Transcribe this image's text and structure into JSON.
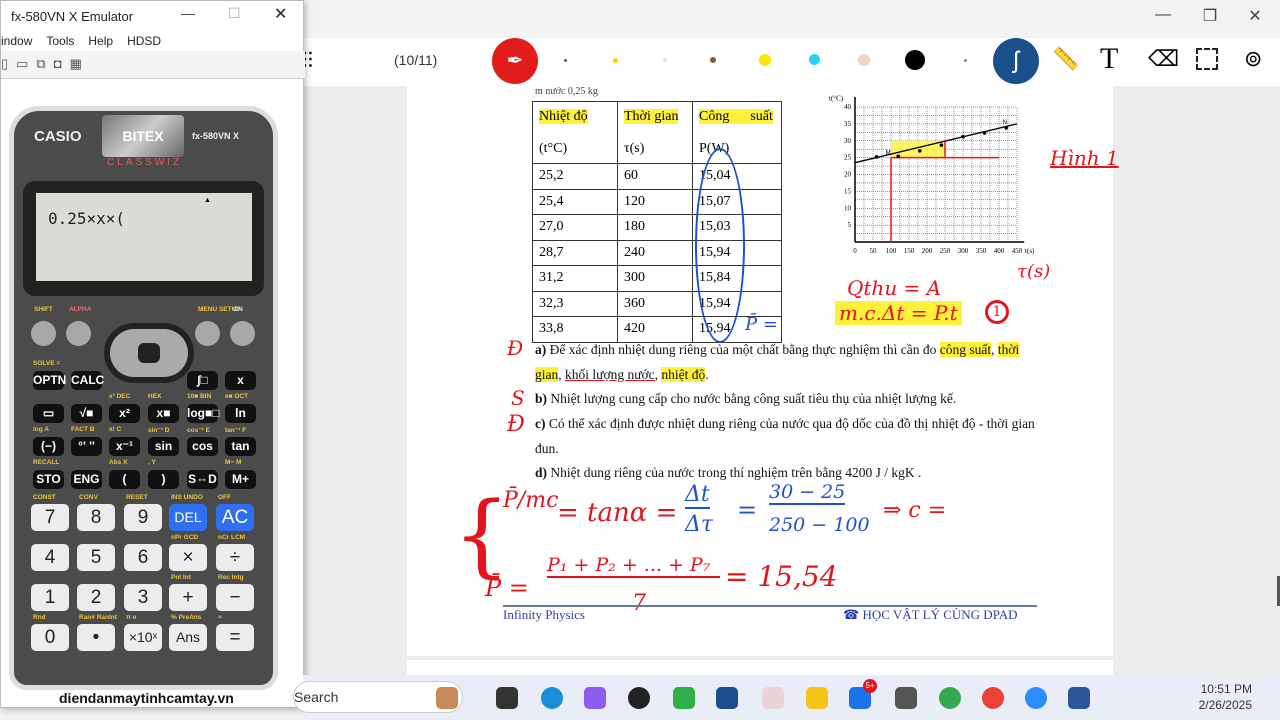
{
  "main_window": {
    "page_indicator": "(10/11)"
  },
  "toolbar": {
    "tools": [
      "pen-tool",
      "ruler-tool",
      "text-tool",
      "eraser-tool",
      "select-tool",
      "view-tool"
    ],
    "colors": [
      "#e21b1b",
      "#1b4f8c",
      "#fff200",
      "#ece4d8",
      "#8b5a2b",
      "#ffe600",
      "#29d2f0",
      "#f1d5c7",
      "#000000"
    ]
  },
  "doc": {
    "top_fragment": "m nước   0,25 kg",
    "table": {
      "headers": [
        [
          "Nhiệt độ",
          "(t°C)"
        ],
        [
          "Thời gian",
          "τ(s)"
        ],
        [
          "Công      suất",
          "P(W)"
        ]
      ],
      "rows": [
        [
          "25,2",
          "60",
          "15,04"
        ],
        [
          "25,4",
          "120",
          "15,07"
        ],
        [
          "27,0",
          "180",
          "15,03"
        ],
        [
          "28,7",
          "240",
          "15,94"
        ],
        [
          "31,2",
          "300",
          "15,84"
        ],
        [
          "32,3",
          "360",
          "15,94"
        ],
        [
          "33,8",
          "420",
          "15,94"
        ]
      ]
    },
    "questions": {
      "a_label": "a)",
      "a1": " Để xác định nhiệt dung riêng của một chất bằng thực nghiệm thì cần đo ",
      "a_hl1": "công suất",
      "a_sep1": ", ",
      "a_hl2": "thời",
      "a_hl3": "gian",
      "a2": ", ",
      "a_hl4": "khối lượng nước",
      "a3": ", ",
      "a_hl5": "nhiệt độ",
      "a4": ".",
      "b_label": "b)",
      "b": " Nhiệt lượng cung cấp cho nước bằng công suất tiêu thụ của nhiệt lượng kế.",
      "c_label": "c)",
      "c1": " Có thể xác định được nhiệt dung riêng của nước qua độ dốc của đồ thị nhiệt độ - thời gian",
      "c2": "đun.",
      "d_label": "d)",
      "d": " Nhiệt dung riêng của nước trong thí nghiệm trên bằng  4200 J / kgK ."
    },
    "footer_left": "Infinity Physics",
    "footer_right": "☎ HỌC VẬT LÝ CÙNG DPAD"
  },
  "chart_data": {
    "type": "scatter",
    "xlabel": "τ(s)",
    "ylabel": "t(°C)",
    "xlim": [
      0,
      450
    ],
    "ylim": [
      0,
      40
    ],
    "xticks": [
      "0",
      "50",
      "100",
      "150",
      "200",
      "250",
      "300",
      "350",
      "400",
      "450"
    ],
    "yticks": [
      "5",
      "10",
      "15",
      "20",
      "25",
      "30",
      "35",
      "40"
    ],
    "points": [
      [
        60,
        25.2
      ],
      [
        120,
        25.4
      ],
      [
        180,
        27.0
      ],
      [
        240,
        28.7
      ],
      [
        300,
        31.2
      ],
      [
        360,
        32.3
      ],
      [
        420,
        33.8
      ]
    ],
    "fit_line": [
      [
        0,
        23.5
      ],
      [
        450,
        35
      ]
    ],
    "point_labels": [
      "M",
      "N"
    ],
    "grid": true
  },
  "annotations": {
    "marks": [
      "Đ",
      "S",
      "Đ"
    ],
    "hinh": "Hình 1",
    "tau": "τ(s)",
    "q1": "Qthu = A",
    "q2": "m.c.Δt = P.t",
    "circle": "1",
    "pbar": "P̄ =",
    "eq1_lhs": "P̄/mc",
    "eq1": "= tanα =",
    "eq1_frac_num": "Δt",
    "eq1_frac_den": "Δτ",
    "eq1_eq": "=",
    "eq1_num": "30 − 25",
    "eq1_den": "250 − 100",
    "eq1_res": "⇒ c =",
    "eq2_lhs": "P̄ =",
    "eq2_num": "P₁ + P₂ + ... + P₇",
    "eq2_den": "7",
    "eq2_res": "= 15,54"
  },
  "emulator": {
    "title": "fx-580VN X Emulator",
    "menu": [
      "indow",
      "Tools",
      "Help",
      "HDSD"
    ],
    "brand": "CASIO",
    "model": "fx-580VN X",
    "series": "CLASSWIZ",
    "sticker": "BITEX",
    "display": "0.25×x×(",
    "website": "diendanmaytinhcamtay.vn",
    "top_labels": [
      "SHIFT",
      "ALPHA",
      "MENU SETUP",
      "ON"
    ],
    "fkeys": [
      [
        "OPTN",
        "CALC",
        "",
        "",
        "∫□",
        "x"
      ],
      [
        "▭",
        "√■",
        "x²",
        "x■",
        "log■□",
        "ln"
      ],
      [
        "(−)",
        "°' ''",
        "x⁻¹",
        "sin",
        "cos",
        "tan"
      ],
      [
        "STO",
        "ENG",
        "(",
        ")",
        "S⇔D",
        "M+"
      ]
    ],
    "fkey_labels": [
      [
        "SOLVE =",
        "",
        "",
        "",
        "",
        ""
      ],
      [
        "",
        "",
        "x³ DEC",
        "HEX",
        "10■ BIN",
        "e■ OCT"
      ],
      [
        "log A",
        "FACT B",
        "x! C",
        "sin⁻¹ D",
        "cos⁻¹ E",
        "tan⁻¹ F"
      ],
      [
        "RECALL",
        "",
        "Abs X",
        ", Y",
        "",
        "M−  M"
      ]
    ],
    "nkeys": [
      [
        "7",
        "8",
        "9",
        "DEL",
        "AC"
      ],
      [
        "4",
        "5",
        "6",
        "×",
        "÷"
      ],
      [
        "1",
        "2",
        "3",
        "+",
        "−"
      ],
      [
        "0",
        "•",
        "×10ˣ",
        "Ans",
        "="
      ]
    ],
    "nkey_labels": [
      [
        "CONST",
        "CONV",
        "RESET",
        "INS UNDO",
        "OFF"
      ],
      [
        "",
        "",
        "",
        "nPr GCD",
        "nCr LCM"
      ],
      [
        "",
        "",
        "",
        "Pol Int",
        "Rec Intg"
      ],
      [
        "Rnd",
        "Ran# RanInt",
        "π  e",
        "% PreAns",
        "≈"
      ]
    ]
  },
  "taskbar": {
    "search": "Search",
    "time": "10:51 PM",
    "date": "2/26/2025",
    "zalo_badge": "5+",
    "apps": [
      "widgets",
      "task-view",
      "edge",
      "copilot",
      "obs",
      "camtasia",
      "paint-splash",
      "app-keys",
      "file-explorer",
      "zalo",
      "calculator-emulator",
      "chrome-profile-d",
      "chrome-profile-2",
      "zoom",
      "word"
    ]
  }
}
